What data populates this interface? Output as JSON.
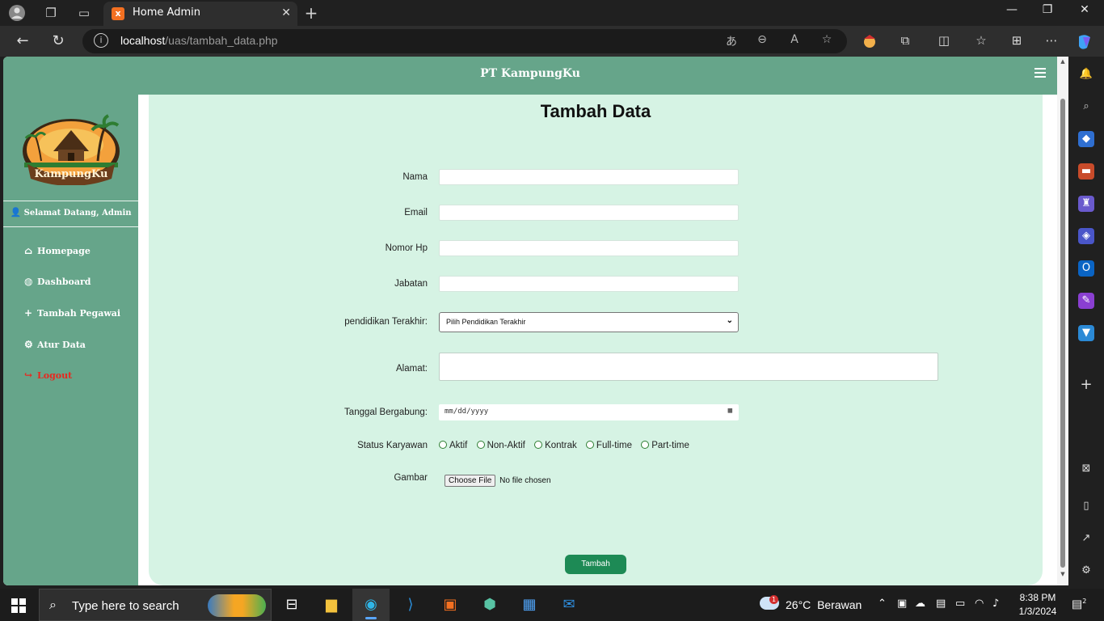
{
  "browser": {
    "tab_title": "Home Admin",
    "url_host": "localhost",
    "url_path": "/uas/tambah_data.php"
  },
  "header": {
    "brand": "PT KampungKu"
  },
  "sidebar": {
    "logo_text": "KampungKu",
    "welcome": "Selamat Datang, Admin",
    "items": [
      {
        "label": "Homepage",
        "icon": "home-icon"
      },
      {
        "label": "Dashboard",
        "icon": "palette-icon"
      },
      {
        "label": "Tambah Pegawai",
        "icon": "plus-icon"
      },
      {
        "label": "Atur Data",
        "icon": "gear-icon"
      },
      {
        "label": "Logout",
        "icon": "sign-out-icon"
      }
    ]
  },
  "form": {
    "title": "Tambah Data",
    "labels": {
      "nama": "Nama",
      "email": "Email",
      "hp": "Nomor Hp",
      "jabatan": "Jabatan",
      "pendidikan": "pendidikan Terakhir:",
      "alamat": "Alamat:",
      "tanggal": "Tanggal Bergabung:",
      "status": "Status Karyawan",
      "gambar": "Gambar"
    },
    "pendidikan_selected": "Pilih Pendidikan Terakhir",
    "date_placeholder": "mm/dd/yyyy",
    "status_options": [
      "Aktif",
      "Non-Aktif",
      "Kontrak",
      "Full-time",
      "Part-time"
    ],
    "file_button": "Choose File",
    "file_status": "No file chosen",
    "submit": "Tambah"
  },
  "taskbar": {
    "search_placeholder": "Type here to search",
    "weather_temp": "26°C",
    "weather_text": "Berawan",
    "weather_badge": "1",
    "time": "8:38 PM",
    "date": "1/3/2024",
    "notifications": "2"
  },
  "colors": {
    "primary": "#66a58a",
    "content_bg": "#d6f3e4",
    "submit": "#1d8a55",
    "logout": "#e8281f"
  }
}
